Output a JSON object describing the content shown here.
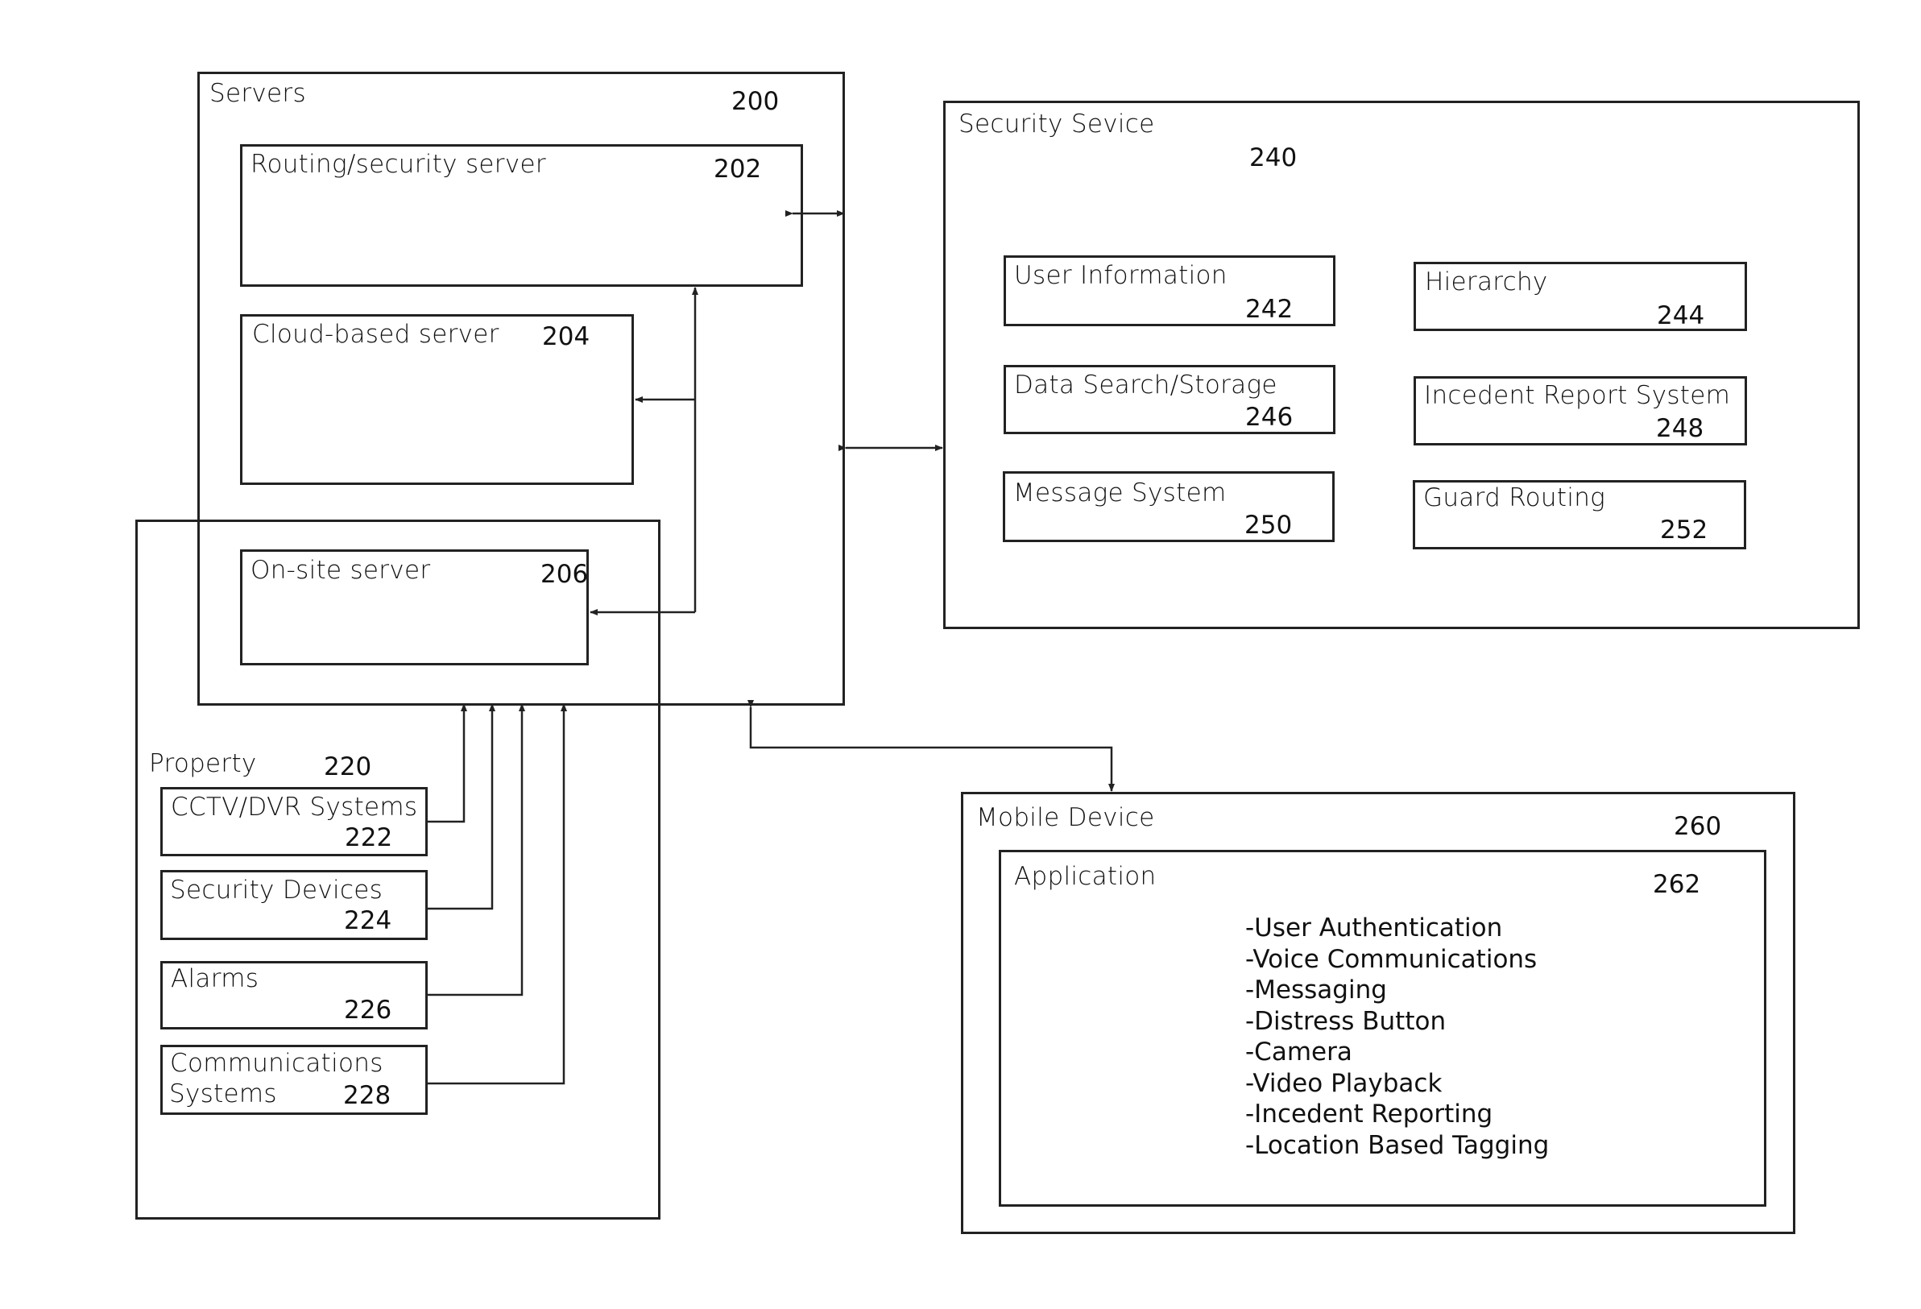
{
  "servers": {
    "title": "Servers",
    "ref": "200",
    "routing": {
      "title": "Routing/security server",
      "ref": "202"
    },
    "cloud": {
      "title": "Cloud-based server",
      "ref": "204"
    },
    "onsite": {
      "title": "On-site server",
      "ref": "206"
    }
  },
  "property": {
    "title": "Property",
    "ref": "220",
    "items": [
      {
        "title": "CCTV/DVR Systems",
        "ref": "222"
      },
      {
        "title": "Security Devices",
        "ref": "224"
      },
      {
        "title": "Alarms",
        "ref": "226"
      },
      {
        "title": "Communications",
        "title2": "Systems",
        "ref": "228"
      }
    ]
  },
  "security_service": {
    "title": "Security Sevice",
    "ref": "240",
    "modules": [
      {
        "title": "User Information",
        "ref": "242"
      },
      {
        "title": "Hierarchy",
        "ref": "244"
      },
      {
        "title": "Data Search/Storage",
        "ref": "246"
      },
      {
        "title": "Incedent Report System",
        "ref": "248"
      },
      {
        "title": "Message System",
        "ref": "250"
      },
      {
        "title": "Guard Routing",
        "ref": "252"
      }
    ]
  },
  "mobile_device": {
    "title": "Mobile Device",
    "ref": "260",
    "application": {
      "title": "Application",
      "ref": "262",
      "features": [
        "-User Authentication",
        "-Voice Communications",
        "-Messaging",
        "-Distress Button",
        "-Camera",
        "-Video Playback",
        "-Incedent Reporting",
        "-Location Based Tagging"
      ]
    }
  }
}
